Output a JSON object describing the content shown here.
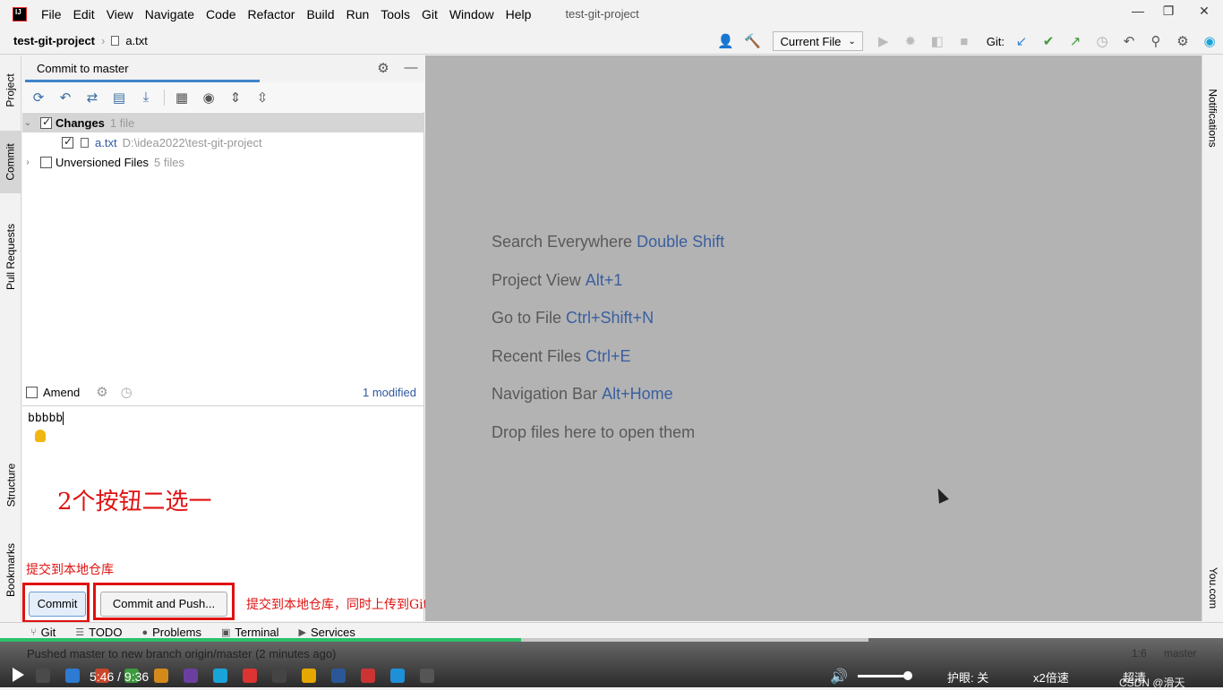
{
  "window": {
    "title": "test-git-project",
    "menu": [
      "File",
      "Edit",
      "View",
      "Navigate",
      "Code",
      "Refactor",
      "Build",
      "Run",
      "Tools",
      "Git",
      "Window",
      "Help"
    ],
    "controls": {
      "minimize": "—",
      "restore": "❐",
      "close": "✕"
    }
  },
  "navbar": {
    "project": "test-git-project",
    "file": "a.txt",
    "run_config": "Current File",
    "git_label": "Git:"
  },
  "left_strip": {
    "tabs": [
      "Project",
      "Commit",
      "Pull Requests",
      "Structure",
      "Bookmarks"
    ]
  },
  "right_strip": {
    "tabs": [
      "Notifications",
      "You.com"
    ]
  },
  "commit_panel": {
    "tab_label": "Commit to master",
    "changes_label": "Changes",
    "changes_count": "1 file",
    "file_name": "a.txt",
    "file_path": "D:\\idea2022\\test-git-project",
    "unversioned_label": "Unversioned Files",
    "unversioned_count": "5 files",
    "amend_label": "Amend",
    "modified_label": "1 modified",
    "commit_message": "bbbbb",
    "commit_button": "Commit",
    "commit_push_button": "Commit and Push..."
  },
  "annotations": {
    "choose_one": "2个按钮二选一",
    "commit_note": "提交到本地仓库",
    "push_note": "提交到本地仓库，同时上传到GitHub"
  },
  "editor_hints": [
    {
      "text": "Search Everywhere",
      "key": "Double Shift"
    },
    {
      "text": "Project View",
      "key": "Alt+1"
    },
    {
      "text": "Go to File",
      "key": "Ctrl+Shift+N"
    },
    {
      "text": "Recent Files",
      "key": "Ctrl+E"
    },
    {
      "text": "Navigation Bar",
      "key": "Alt+Home"
    },
    {
      "text": "Drop files here to open them",
      "key": ""
    }
  ],
  "bottom_tabs": [
    "Git",
    "TODO",
    "Problems",
    "Terminal",
    "Services"
  ],
  "status": {
    "message": "Pushed master to new branch origin/master (2 minutes ago)",
    "position": "1:6",
    "branch": "master"
  },
  "video": {
    "time": "5:46 / 9:36",
    "progress": 0.6,
    "volume": 0.9,
    "eye_label": "护眼: 关",
    "speed_label": "x2倍速",
    "quality_label": "超清",
    "watermark": "CSDN @滑天"
  }
}
